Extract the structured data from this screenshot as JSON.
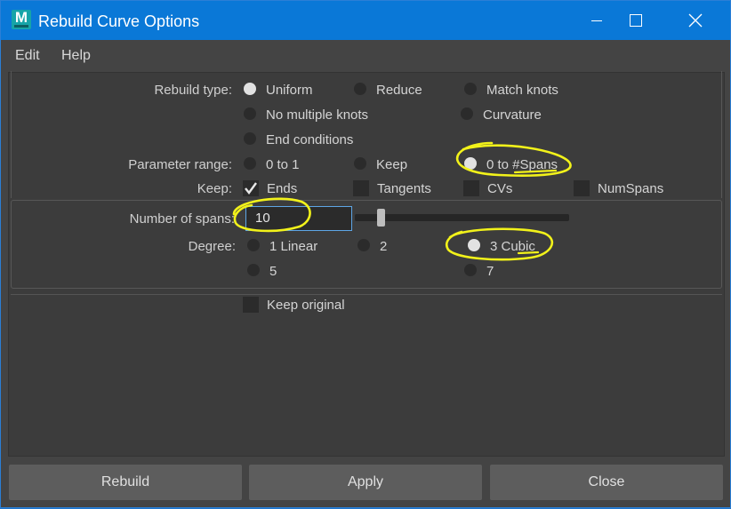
{
  "window": {
    "title": "Rebuild Curve Options",
    "app_icon": "maya-icon",
    "app_icon_letter": "M",
    "controls": [
      "minimize-icon",
      "maximize-icon",
      "close-icon"
    ]
  },
  "menu": {
    "items": [
      "Edit",
      "Help"
    ]
  },
  "rebuild_type": {
    "label": "Rebuild type:",
    "options": [
      "Uniform",
      "Reduce",
      "Match knots",
      "No multiple knots",
      "Curvature",
      "End conditions"
    ],
    "selected": "Uniform"
  },
  "parameter_range": {
    "label": "Parameter range:",
    "options": [
      "0 to 1",
      "Keep",
      "0 to #Spans"
    ],
    "selected": "0 to #Spans"
  },
  "keep": {
    "label": "Keep:",
    "options": [
      "Ends",
      "Tangents",
      "CVs",
      "NumSpans"
    ],
    "checked": [
      "Ends"
    ]
  },
  "spans": {
    "label": "Number of spans:",
    "value": "10"
  },
  "degree": {
    "label": "Degree:",
    "options": [
      "1 Linear",
      "2",
      "3 Cubic",
      "5",
      "7"
    ],
    "selected": "3 Cubic"
  },
  "keep_original": {
    "label": "Keep original",
    "checked": false
  },
  "buttons": {
    "rebuild": "Rebuild",
    "apply": "Apply",
    "close": "Close"
  },
  "colors": {
    "title_bar": "#0a78d7",
    "panel": "#3c3c3c",
    "highlight": "#f2f21a"
  }
}
